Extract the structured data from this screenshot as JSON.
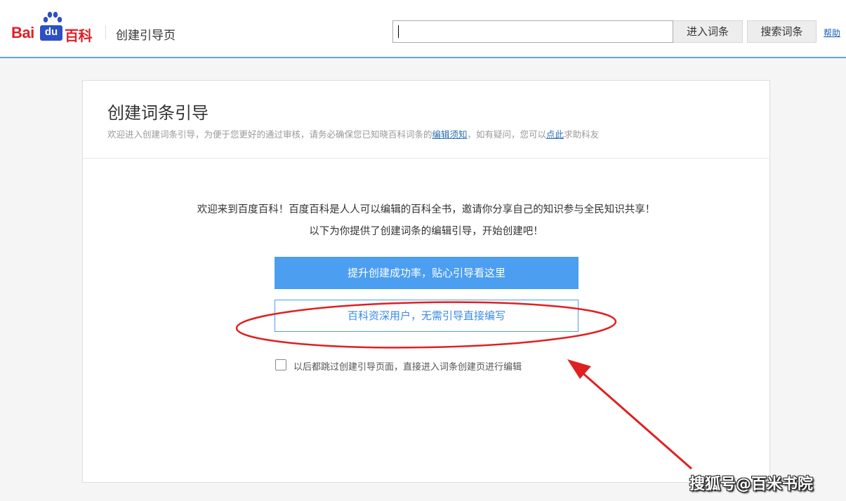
{
  "header": {
    "logo": {
      "part1": "Bai",
      "part2": "du",
      "part3": "百科"
    },
    "page_name": "创建引导页",
    "search": {
      "value": "",
      "placeholder": ""
    },
    "enter_button": "进入词条",
    "search_button": "搜索词条",
    "help_link": "帮助"
  },
  "card": {
    "title": "创建词条引导",
    "subtitle": {
      "part1": "欢迎进入创建词条引导，为便于您更好的通过审核，请务必确保您已知晓百科词条的",
      "link1": "编辑须知",
      "part2": "，如有疑问，您可以",
      "link2": "点此",
      "part3": "求助科友"
    },
    "intro_line1": "欢迎来到百度百科！百度百科是人人可以编辑的百科全书，邀请你分享自己的知识参与全民知识共享！",
    "intro_line2": "以下为你提供了创建词条的编辑引导，开始创建吧！",
    "primary_button": "提升创建成功率，贴心引导看这里",
    "secondary_button": "百科资深用户，无需引导直接编写",
    "skip_checkbox": {
      "checked": false,
      "label": "以后都跳过创建引导页面，直接进入词条创建页进行编辑"
    }
  },
  "watermark": "搜狐号@百米书院",
  "colors": {
    "accent": "#4b9ef0",
    "header_border": "#60a5e8",
    "brand_red": "#de1f26",
    "brand_blue": "#2d50c5",
    "annotation_red": "#e02020",
    "link": "#2b6eb8"
  }
}
